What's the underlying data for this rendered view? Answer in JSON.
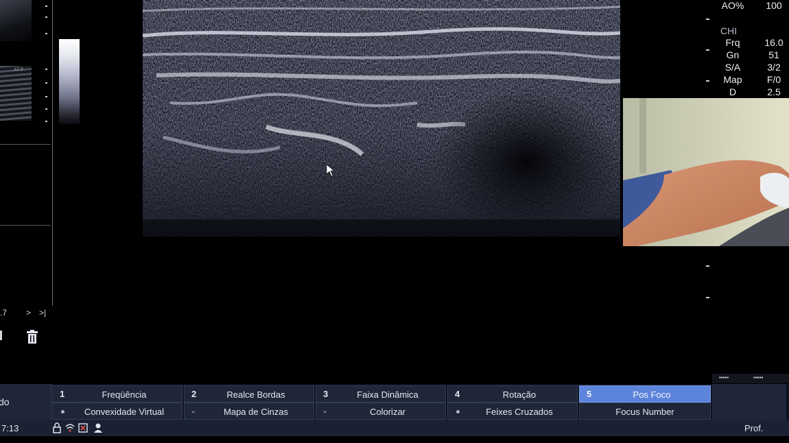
{
  "nav": {
    "left_value": ".7",
    "next": ">",
    "last": ">|"
  },
  "params": [
    {
      "label": "AO%",
      "value": "100"
    },
    {
      "label": "Frq",
      "value": "16.0"
    },
    {
      "label": "Gn",
      "value": "51"
    },
    {
      "label": "S/A",
      "value": "3/2"
    },
    {
      "label": "Map",
      "value": "F/0"
    },
    {
      "label": "D",
      "value": "2.5"
    }
  ],
  "chi_label": "CHI",
  "mode_label": "do",
  "softkeys_top": [
    {
      "num": "1",
      "label": "Freqüência"
    },
    {
      "num": "2",
      "label": "Realce Bordas"
    },
    {
      "num": "3",
      "label": "Faixa Dinâmica"
    },
    {
      "num": "4",
      "label": "Rotação"
    },
    {
      "num": "5",
      "label": "Pos Foco"
    }
  ],
  "softkeys_bottom": [
    {
      "label": "Convexidade Virtual"
    },
    {
      "label": "Mapa de Cinzas"
    },
    {
      "label": "Colorizar"
    },
    {
      "label": "Feixes Cruzados"
    },
    {
      "label": "Focus Number"
    }
  ],
  "status": {
    "time": "7:13",
    "profile": "Prof."
  },
  "colors": {
    "active_softkey": "#5d84db",
    "softkey_bg": "#1e2638",
    "bar_bg": "#0e1320"
  },
  "icons": [
    "delete-icon",
    "lock-icon",
    "network-icon",
    "record-icon",
    "user-icon"
  ]
}
